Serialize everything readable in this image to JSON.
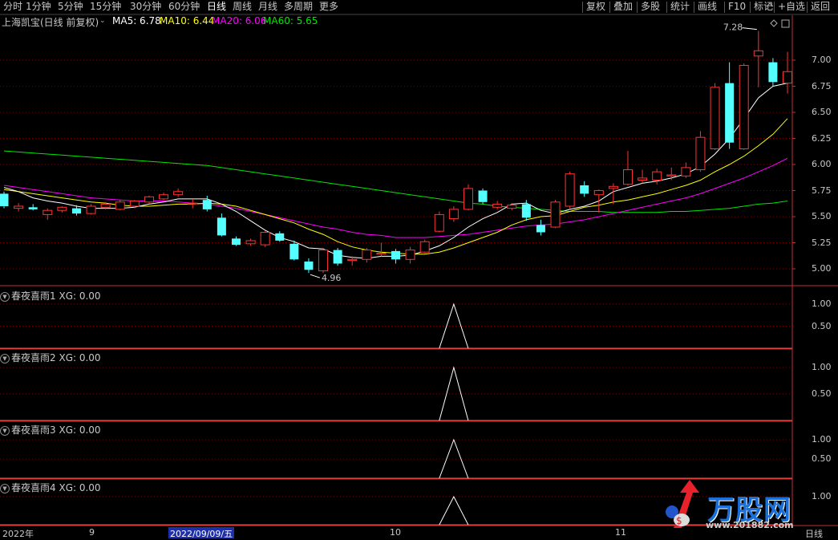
{
  "toolbar": {
    "periods": [
      "分时",
      "1分钟",
      "5分钟",
      "15分钟",
      "30分钟",
      "60分钟",
      "日线",
      "周线",
      "月线",
      "多周期",
      "更多"
    ],
    "active_period": "日线",
    "right_buttons": [
      "复权",
      "叠加",
      "多股",
      "统计",
      "画线",
      "F10",
      "标记",
      "+自选",
      "返回"
    ]
  },
  "header": {
    "stock": "上海凯宝(日线 前复权)",
    "ma5_label": "MA5: 6.78",
    "ma10_label": "MA10: 6.44",
    "ma20_label": "MA20: 6.06",
    "ma60_label": "MA60: 5.65"
  },
  "colors": {
    "up": "#ff3232",
    "down": "#54ffff",
    "ma5": "#ffffff",
    "ma10": "#ffff00",
    "ma20": "#ff00ff",
    "ma60": "#00e600",
    "grid": "#7a0000",
    "axis": "#c03030"
  },
  "chart_data": [
    {
      "type": "candlestick",
      "title": "上海凯宝(日线 前复权)",
      "y_ticks": [
        "7.00",
        "6.75",
        "6.50",
        "6.25",
        "6.00",
        "5.75",
        "5.50",
        "5.25",
        "5.00"
      ],
      "ylim": [
        4.83,
        7.36
      ],
      "annotations": {
        "high": "7.28",
        "low": "4.96"
      },
      "ohlc": [
        [
          5.72,
          5.74,
          5.58,
          5.6
        ],
        [
          5.58,
          5.63,
          5.55,
          5.6
        ],
        [
          5.59,
          5.62,
          5.56,
          5.57
        ],
        [
          5.52,
          5.58,
          5.47,
          5.56
        ],
        [
          5.56,
          5.6,
          5.54,
          5.59
        ],
        [
          5.58,
          5.61,
          5.51,
          5.53
        ],
        [
          5.53,
          5.62,
          5.52,
          5.6
        ],
        [
          5.59,
          5.64,
          5.57,
          5.62
        ],
        [
          5.57,
          5.66,
          5.56,
          5.64
        ],
        [
          5.6,
          5.66,
          5.58,
          5.65
        ],
        [
          5.64,
          5.7,
          5.62,
          5.69
        ],
        [
          5.67,
          5.73,
          5.66,
          5.71
        ],
        [
          5.71,
          5.77,
          5.69,
          5.74
        ],
        [
          5.63,
          5.67,
          5.58,
          5.63
        ],
        [
          5.66,
          5.7,
          5.55,
          5.57
        ],
        [
          5.49,
          5.53,
          5.31,
          5.32
        ],
        [
          5.29,
          5.31,
          5.22,
          5.23
        ],
        [
          5.24,
          5.29,
          5.22,
          5.27
        ],
        [
          5.23,
          5.36,
          5.21,
          5.35
        ],
        [
          5.34,
          5.36,
          5.26,
          5.27
        ],
        [
          5.24,
          5.27,
          5.08,
          5.09
        ],
        [
          5.07,
          5.1,
          4.96,
          4.99
        ],
        [
          4.98,
          5.2,
          4.96,
          5.18
        ],
        [
          5.18,
          5.2,
          5.03,
          5.05
        ],
        [
          5.08,
          5.12,
          5.03,
          5.09
        ],
        [
          5.09,
          5.2,
          5.06,
          5.18
        ],
        [
          5.14,
          5.25,
          5.12,
          5.15
        ],
        [
          5.17,
          5.19,
          5.05,
          5.09
        ],
        [
          5.09,
          5.21,
          5.05,
          5.18
        ],
        [
          5.16,
          5.28,
          5.15,
          5.26
        ],
        [
          5.36,
          5.55,
          5.35,
          5.52
        ],
        [
          5.48,
          5.6,
          5.45,
          5.57
        ],
        [
          5.57,
          5.81,
          5.56,
          5.77
        ],
        [
          5.75,
          5.77,
          5.62,
          5.64
        ],
        [
          5.59,
          5.65,
          5.57,
          5.62
        ],
        [
          5.58,
          5.63,
          5.56,
          5.61
        ],
        [
          5.62,
          5.66,
          5.46,
          5.49
        ],
        [
          5.42,
          5.47,
          5.32,
          5.35
        ],
        [
          5.4,
          5.66,
          5.39,
          5.64
        ],
        [
          5.6,
          5.93,
          5.58,
          5.91
        ],
        [
          5.8,
          5.84,
          5.69,
          5.72
        ],
        [
          5.71,
          5.76,
          5.54,
          5.75
        ],
        [
          5.77,
          5.82,
          5.62,
          5.79
        ],
        [
          5.81,
          6.13,
          5.8,
          5.95
        ],
        [
          5.85,
          5.95,
          5.82,
          5.87
        ],
        [
          5.85,
          5.96,
          5.81,
          5.93
        ],
        [
          5.89,
          5.97,
          5.85,
          5.9
        ],
        [
          5.89,
          6.02,
          5.87,
          5.97
        ],
        [
          5.95,
          6.32,
          5.93,
          6.26
        ],
        [
          6.15,
          6.78,
          6.14,
          6.74
        ],
        [
          6.78,
          6.98,
          6.15,
          6.21
        ],
        [
          6.15,
          6.97,
          6.14,
          6.95
        ],
        [
          7.04,
          7.28,
          6.74,
          7.09
        ],
        [
          6.98,
          7.02,
          6.75,
          6.79
        ],
        [
          6.78,
          7.08,
          6.68,
          6.89
        ]
      ],
      "ma5": [
        5.78,
        5.74,
        5.68,
        5.65,
        5.63,
        5.6,
        5.58,
        5.58,
        5.58,
        5.59,
        5.62,
        5.64,
        5.67,
        5.67,
        5.67,
        5.62,
        5.55,
        5.46,
        5.37,
        5.3,
        5.26,
        5.2,
        5.19,
        5.13,
        5.11,
        5.1,
        5.12,
        5.12,
        5.13,
        5.17,
        5.22,
        5.3,
        5.4,
        5.48,
        5.54,
        5.62,
        5.63,
        5.56,
        5.53,
        5.57,
        5.6,
        5.65,
        5.74,
        5.78,
        5.82,
        5.84,
        5.87,
        5.91,
        5.98,
        6.1,
        6.25,
        6.44,
        6.64,
        6.75,
        6.78
      ],
      "ma10": [
        5.76,
        5.74,
        5.72,
        5.7,
        5.68,
        5.66,
        5.64,
        5.63,
        5.61,
        5.6,
        5.6,
        5.61,
        5.62,
        5.62,
        5.63,
        5.62,
        5.6,
        5.56,
        5.52,
        5.48,
        5.44,
        5.38,
        5.33,
        5.26,
        5.21,
        5.18,
        5.16,
        5.15,
        5.14,
        5.14,
        5.16,
        5.2,
        5.25,
        5.3,
        5.35,
        5.42,
        5.47,
        5.5,
        5.51,
        5.55,
        5.59,
        5.61,
        5.64,
        5.66,
        5.69,
        5.72,
        5.76,
        5.8,
        5.85,
        5.93,
        6.0,
        6.08,
        6.18,
        6.29,
        6.44
      ],
      "ma20": [
        5.8,
        5.78,
        5.76,
        5.74,
        5.72,
        5.7,
        5.68,
        5.67,
        5.66,
        5.65,
        5.65,
        5.65,
        5.64,
        5.63,
        5.62,
        5.6,
        5.58,
        5.55,
        5.52,
        5.49,
        5.46,
        5.43,
        5.4,
        5.38,
        5.35,
        5.33,
        5.32,
        5.3,
        5.3,
        5.3,
        5.31,
        5.32,
        5.33,
        5.35,
        5.37,
        5.39,
        5.41,
        5.42,
        5.43,
        5.45,
        5.47,
        5.5,
        5.53,
        5.56,
        5.59,
        5.62,
        5.65,
        5.68,
        5.72,
        5.77,
        5.82,
        5.87,
        5.93,
        5.99,
        6.06
      ],
      "ma60": [
        6.13,
        6.12,
        6.11,
        6.1,
        6.09,
        6.08,
        6.07,
        6.06,
        6.05,
        6.04,
        6.03,
        6.02,
        6.01,
        6.0,
        5.99,
        5.97,
        5.95,
        5.93,
        5.91,
        5.89,
        5.87,
        5.85,
        5.83,
        5.81,
        5.79,
        5.77,
        5.75,
        5.73,
        5.71,
        5.69,
        5.67,
        5.65,
        5.63,
        5.62,
        5.6,
        5.59,
        5.58,
        5.57,
        5.56,
        5.55,
        5.55,
        5.55,
        5.54,
        5.54,
        5.54,
        5.54,
        5.55,
        5.55,
        5.56,
        5.57,
        5.58,
        5.6,
        5.62,
        5.63,
        5.65
      ],
      "x_labels": [
        "2022年",
        "9",
        "2022/09/09/五",
        "10",
        "11",
        "日线"
      ]
    },
    {
      "type": "line",
      "panels": [
        {
          "title": "春夜喜雨1",
          "value_label": "XG: 0.00",
          "y_ticks": [
            "1.00",
            "0.50"
          ]
        },
        {
          "title": "春夜喜雨2",
          "value_label": "XG: 0.00",
          "y_ticks": [
            "1.00",
            "0.50"
          ]
        },
        {
          "title": "春夜喜雨3",
          "value_label": "XG: 0.00",
          "y_ticks": [
            "1.00",
            "0.50"
          ]
        },
        {
          "title": "春夜喜雨4",
          "value_label": "XG: 0.00",
          "y_ticks": [
            "1.00"
          ]
        }
      ],
      "signal": [
        0,
        0,
        0,
        0,
        0,
        0,
        0,
        0,
        0,
        0,
        0,
        0,
        0,
        0,
        0,
        0,
        0,
        0,
        0,
        0,
        0,
        0,
        0,
        0,
        0,
        0,
        0,
        0,
        0,
        0,
        0,
        1,
        0,
        0,
        0,
        0,
        0,
        0,
        0,
        0,
        0,
        0,
        0,
        0,
        0,
        0,
        0,
        0,
        0,
        0,
        0,
        0,
        0,
        0,
        0
      ]
    }
  ],
  "watermark": {
    "brand": "万股网",
    "url": "www.201882.com"
  }
}
